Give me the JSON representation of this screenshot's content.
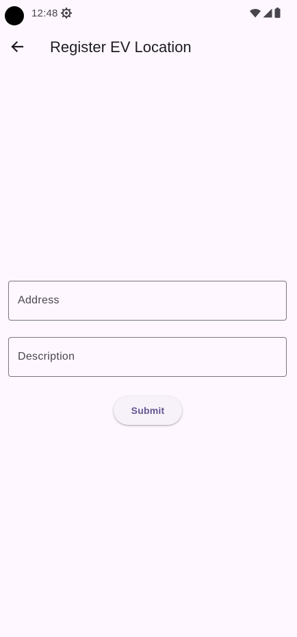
{
  "status_bar": {
    "time": "12:48",
    "icons": [
      "settings-gear-icon",
      "wifi-icon",
      "cellular-signal-icon",
      "battery-icon"
    ]
  },
  "app_bar": {
    "back_icon": "arrow-back-icon",
    "title": "Register EV Location"
  },
  "form": {
    "address": {
      "value": "",
      "placeholder": "Address"
    },
    "description": {
      "value": "",
      "placeholder": "Description"
    },
    "submit_label": "Submit"
  },
  "colors": {
    "background": "#fef7ff",
    "outline": "#79747e",
    "button_text": "#65558f",
    "button_surface": "#f7f2fa"
  }
}
